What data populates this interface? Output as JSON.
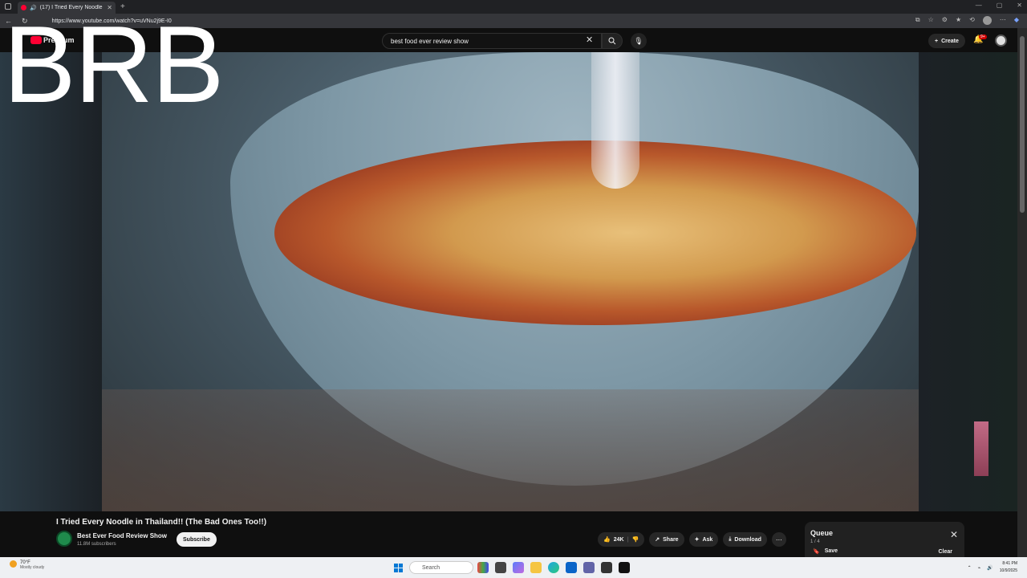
{
  "browser": {
    "tab_title": "(17) I Tried Every Noodle in",
    "url": "https://www.youtube.com/watch?v=uVNu2j9E-I0"
  },
  "youtube": {
    "logo_text": "Premium",
    "search_value": "best food ever review show",
    "create_label": "Create",
    "notification_count": "9+"
  },
  "overlay": {
    "text": "BRB"
  },
  "video": {
    "title": "I Tried Every Noodle in Thailand!! (The Bad Ones Too!!)",
    "channel_name": "Best Ever Food Review Show",
    "subscribers": "11.8M subscribers",
    "subscribe_label": "Subscribe",
    "likes": "24K",
    "share_label": "Share",
    "ask_label": "Ask",
    "download_label": "Download"
  },
  "queue": {
    "title": "Queue",
    "count": "1 / 4",
    "save_label": "Save",
    "clear_label": "Clear"
  },
  "taskbar": {
    "temperature": "70°F",
    "weather": "Mostly cloudy",
    "search_placeholder": "Search",
    "time": "8:41 PM",
    "date": "10/9/2025"
  },
  "colors": {
    "youtube_red": "#ff0033",
    "background": "#0f0f0f",
    "pill": "#272727"
  }
}
